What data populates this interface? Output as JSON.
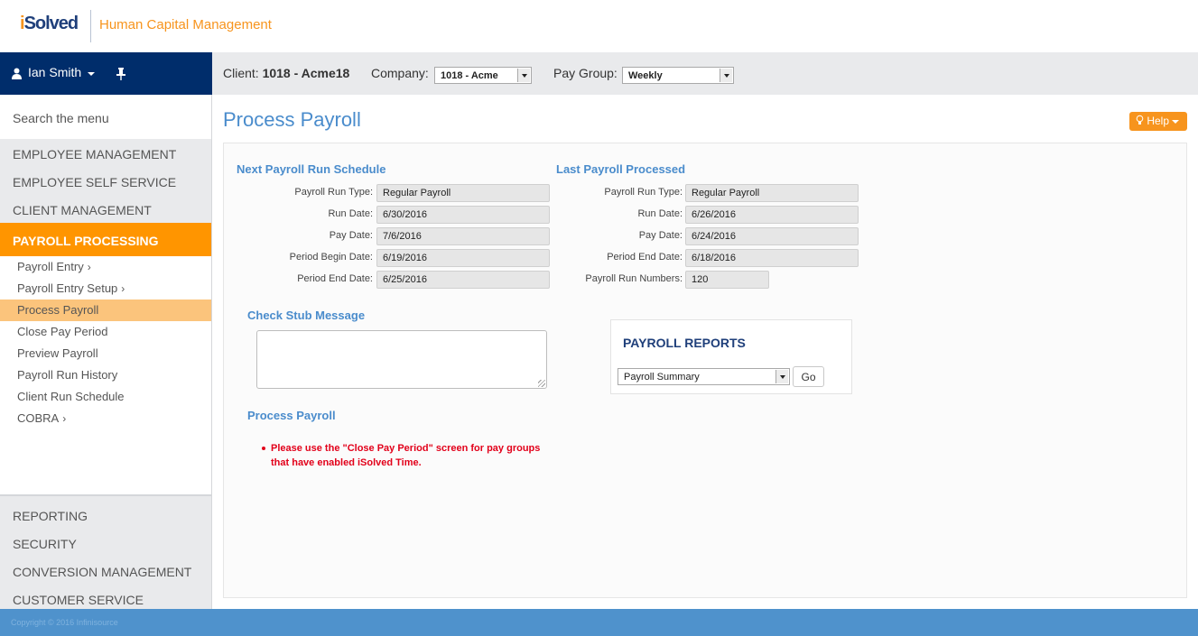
{
  "header": {
    "logo_prefix": "i",
    "logo_rest": "Solved",
    "app_title": "Human Capital Management"
  },
  "user": {
    "name": "Ian Smith"
  },
  "context": {
    "client_label": "Client:",
    "client_value": "1018 - Acme18",
    "company_label": "Company:",
    "company_value": "1018 - Acme",
    "paygroup_label": "Pay Group:",
    "paygroup_value": "Weekly"
  },
  "sidebar": {
    "search_placeholder": "Search the menu",
    "top_items": [
      "EMPLOYEE MANAGEMENT",
      "EMPLOYEE SELF SERVICE",
      "CLIENT MANAGEMENT"
    ],
    "active_section": "PAYROLL PROCESSING",
    "sub_items": [
      {
        "label": "Payroll Entry",
        "chevron": true
      },
      {
        "label": "Payroll Entry Setup",
        "chevron": true
      },
      {
        "label": "Process Payroll",
        "selected": true
      },
      {
        "label": "Close Pay Period"
      },
      {
        "label": "Preview Payroll"
      },
      {
        "label": "Payroll Run History"
      },
      {
        "label": "Client Run Schedule"
      },
      {
        "label": "COBRA",
        "chevron": true
      }
    ],
    "bottom_items": [
      "REPORTING",
      "SECURITY",
      "CONVERSION MANAGEMENT",
      "CUSTOMER SERVICE"
    ]
  },
  "main": {
    "title": "Process Payroll",
    "help_label": "Help",
    "next_run": {
      "title": "Next Payroll Run Schedule",
      "fields": [
        {
          "label": "Payroll Run Type:",
          "value": "Regular Payroll"
        },
        {
          "label": "Run Date:",
          "value": "6/30/2016"
        },
        {
          "label": "Pay Date:",
          "value": "7/6/2016"
        },
        {
          "label": "Period Begin Date:",
          "value": "6/19/2016"
        },
        {
          "label": "Period End Date:",
          "value": "6/25/2016"
        }
      ]
    },
    "last_run": {
      "title": "Last Payroll Processed",
      "fields": [
        {
          "label": "Payroll Run Type:",
          "value": "Regular Payroll"
        },
        {
          "label": "Run Date:",
          "value": "6/26/2016"
        },
        {
          "label": "Pay Date:",
          "value": "6/24/2016"
        },
        {
          "label": "Period End Date:",
          "value": "6/18/2016"
        },
        {
          "label": "Payroll Run Numbers:",
          "value": "120"
        }
      ]
    },
    "check_stub": {
      "title": "Check Stub Message",
      "value": ""
    },
    "process_section": {
      "title": "Process Payroll",
      "notice": "Please use the \"Close Pay Period\" screen for pay groups that have enabled iSolved Time."
    },
    "reports": {
      "title": "PAYROLL REPORTS",
      "selected": "Payroll Summary",
      "go_label": "Go"
    }
  },
  "footer": {
    "copyright": "Copyright © 2016 Infinisource"
  }
}
